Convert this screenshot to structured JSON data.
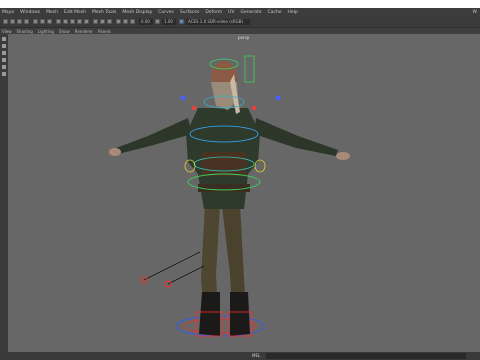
{
  "menu": {
    "items": [
      "Maya",
      "Windows",
      "Mesh",
      "Edit Mesh",
      "Mesh Tools",
      "Mesh Display",
      "Curves",
      "Surfaces",
      "Deform",
      "UV",
      "Generate",
      "Cache",
      "Help"
    ],
    "right_label": "W"
  },
  "toolbar": {
    "field1": "0.00",
    "field2": "1.00",
    "colorspace": "ACES 1.0 SDR-video (sRGB)"
  },
  "panel_menu": [
    "View",
    "Shading",
    "Lighting",
    "Show",
    "Renderer",
    "Panels"
  ],
  "viewport": {
    "label": "persp"
  },
  "status": {
    "mel_label": "MEL"
  }
}
